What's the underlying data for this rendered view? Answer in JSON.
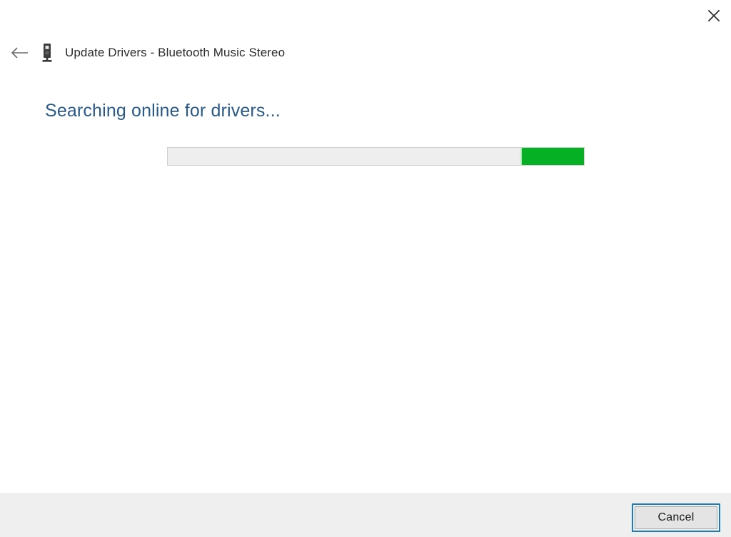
{
  "window": {
    "title": "Update Drivers - Bluetooth Music Stereo",
    "device_icon_name": "bluetooth-speaker-icon",
    "close_icon_name": "close-icon",
    "back_icon_name": "back-arrow-icon"
  },
  "content": {
    "heading": "Searching online for drivers...",
    "progress": {
      "mode": "indeterminate",
      "chunk_color": "#06b025",
      "track_color": "#eeeeee",
      "track_border_color": "#cfcfcf"
    }
  },
  "footer": {
    "cancel_label": "Cancel"
  },
  "colors": {
    "heading_blue": "#2b5a88",
    "title_text": "#2b2b2b",
    "accent_green": "#06b025",
    "focus_blue": "#1f7bb6",
    "footer_background": "#efefef",
    "window_background": "#ffffff"
  }
}
